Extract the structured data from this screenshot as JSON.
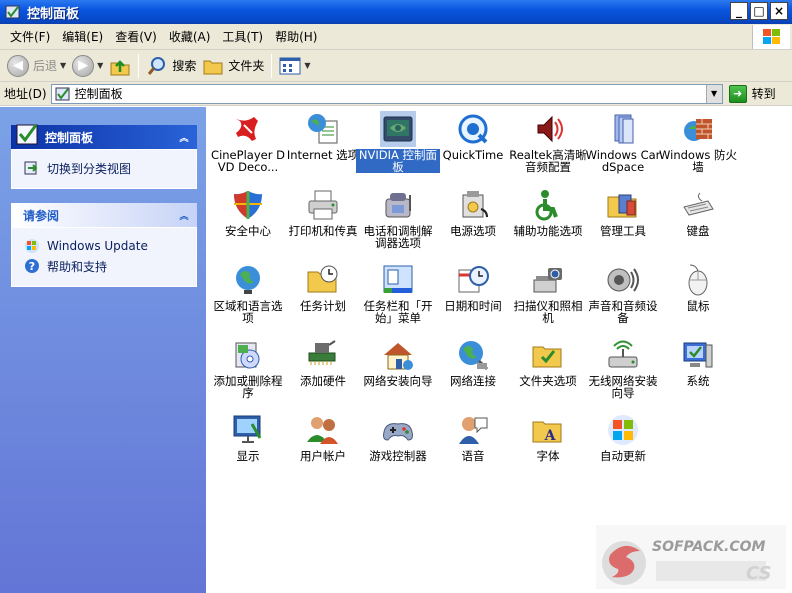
{
  "window": {
    "title": "控制面板"
  },
  "window_buttons": {
    "minimize": "_",
    "maximize": "□",
    "close": "×"
  },
  "menu": [
    {
      "id": "file",
      "label": "文件(F)"
    },
    {
      "id": "edit",
      "label": "编辑(E)"
    },
    {
      "id": "view",
      "label": "查看(V)"
    },
    {
      "id": "favorites",
      "label": "收藏(A)"
    },
    {
      "id": "tools",
      "label": "工具(T)"
    },
    {
      "id": "help",
      "label": "帮助(H)"
    }
  ],
  "toolbar": {
    "back": "后退",
    "search": "搜索",
    "folders": "文件夹"
  },
  "address": {
    "label": "地址(D)",
    "value": "控制面板",
    "go": "转到"
  },
  "left_panel": {
    "cp_title": "控制面板",
    "switch_view": "切换到分类视图",
    "see_also_title": "请参阅",
    "see_also": [
      "Windows Update",
      "帮助和支持"
    ]
  },
  "items": [
    {
      "name": "cineplayer",
      "icon": "cineplayer-icon",
      "label": "CinePlayer DVD Deco..."
    },
    {
      "name": "internet-options",
      "icon": "globe-document-icon",
      "label": "Internet 选项"
    },
    {
      "name": "nvidia-control-panel",
      "icon": "nvidia-icon",
      "label": "NVIDIA 控制面板",
      "selected": true
    },
    {
      "name": "quicktime",
      "icon": "quicktime-icon",
      "label": "QuickTime"
    },
    {
      "name": "realtek-audio",
      "icon": "speaker-icon",
      "label": "Realtek高清晰音频配置"
    },
    {
      "name": "windows-cardspace",
      "icon": "cardspace-icon",
      "label": "Windows CardSpace"
    },
    {
      "name": "windows-firewall",
      "icon": "firewall-icon",
      "label": "Windows 防火墙"
    },
    {
      "name": "security-center",
      "icon": "shield-icon",
      "label": "安全中心"
    },
    {
      "name": "printers-faxes",
      "icon": "printer-icon",
      "label": "打印机和传真"
    },
    {
      "name": "phone-modem",
      "icon": "phone-icon",
      "label": "电话和调制解调器选项"
    },
    {
      "name": "power-options",
      "icon": "power-icon",
      "label": "电源选项"
    },
    {
      "name": "accessibility",
      "icon": "accessibility-icon",
      "label": "辅助功能选项"
    },
    {
      "name": "admin-tools",
      "icon": "admin-tools-icon",
      "label": "管理工具"
    },
    {
      "name": "keyboard",
      "icon": "keyboard-icon",
      "label": "键盘"
    },
    {
      "name": "regional-language",
      "icon": "globe-icon",
      "label": "区域和语言选项"
    },
    {
      "name": "scheduled-tasks",
      "icon": "task-folder-icon",
      "label": "任务计划"
    },
    {
      "name": "taskbar-start-menu",
      "icon": "taskbar-icon",
      "label": "任务栏和「开始」菜单"
    },
    {
      "name": "date-time",
      "icon": "clock-icon",
      "label": "日期和时间"
    },
    {
      "name": "scanners-cameras",
      "icon": "scanner-icon",
      "label": "扫描仪和照相机"
    },
    {
      "name": "sounds-audio",
      "icon": "sound-icon",
      "label": "声音和音频设备"
    },
    {
      "name": "mouse",
      "icon": "mouse-icon",
      "label": "鼠标"
    },
    {
      "name": "add-remove-programs",
      "icon": "add-remove-icon",
      "label": "添加或删除程序"
    },
    {
      "name": "add-hardware",
      "icon": "hardware-icon",
      "label": "添加硬件"
    },
    {
      "name": "network-setup-wizard",
      "icon": "house-icon",
      "label": "网络安装向导"
    },
    {
      "name": "network-connections",
      "icon": "network-globe-icon",
      "label": "网络连接"
    },
    {
      "name": "folder-options",
      "icon": "folder-icon",
      "label": "文件夹选项"
    },
    {
      "name": "wireless-setup-wizard",
      "icon": "wireless-icon",
      "label": "无线网络安装向导"
    },
    {
      "name": "system",
      "icon": "system-icon",
      "label": "系统"
    },
    {
      "name": "display",
      "icon": "display-icon",
      "label": "显示"
    },
    {
      "name": "user-accounts",
      "icon": "users-icon",
      "label": "用户帐户"
    },
    {
      "name": "game-controllers",
      "icon": "gamepad-icon",
      "label": "游戏控制器"
    },
    {
      "name": "speech",
      "icon": "speech-icon",
      "label": "语音"
    },
    {
      "name": "fonts",
      "icon": "fonts-folder-icon",
      "label": "字体"
    },
    {
      "name": "automatic-updates",
      "icon": "windows-logo-icon",
      "label": "自动更新"
    }
  ],
  "watermark": {
    "text": "SOFPACK.COM"
  }
}
